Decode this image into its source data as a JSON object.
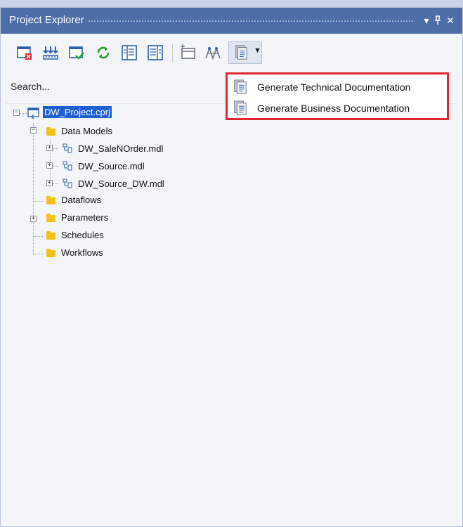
{
  "panel": {
    "title": "Project Explorer",
    "controls": {
      "dropdown": "▾",
      "pin": "ᵖ",
      "close": "✕"
    }
  },
  "toolbar": {
    "tools": [
      "close-project-icon",
      "rebuild-icon",
      "validate-icon",
      "refresh-icon",
      "expand-panel-icon",
      "collapse-panel-icon",
      "add-item-icon",
      "lineage-icon",
      "documentation-icon"
    ]
  },
  "search": {
    "placeholder": "Search..."
  },
  "tree": {
    "project": "DW_Project.cprj",
    "data_models": "Data Models",
    "models": [
      "DW_SaleNOrder.mdl",
      "DW_Source.mdl",
      "DW_Source_DW.mdl"
    ],
    "dataflows": "Dataflows",
    "parameters": "Parameters",
    "schedules": "Schedules",
    "workflows": "Workflows"
  },
  "menu": {
    "items": [
      {
        "label": "Generate Technical Documentation"
      },
      {
        "label": "Generate Business Documentation"
      }
    ]
  },
  "colors": {
    "titlebar": "#4d6ea6",
    "highlight_border": "#e0262f",
    "selection": "#1f5fd1"
  }
}
